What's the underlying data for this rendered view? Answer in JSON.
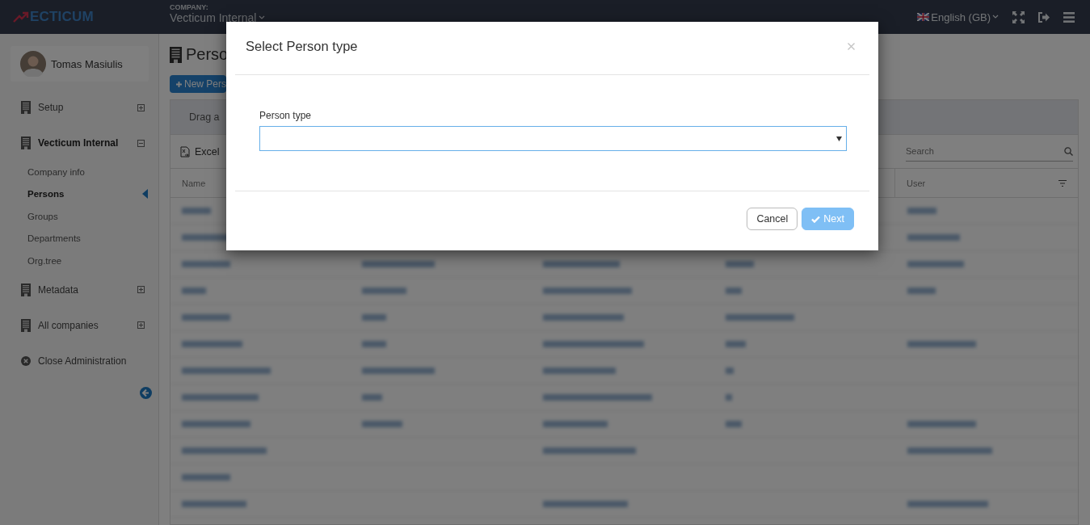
{
  "header": {
    "logo": "ECTICUM",
    "company_label": "COMPANY:",
    "company": "Vecticum Internal",
    "language": "English (GB)"
  },
  "sidebar": {
    "user": "Tomas Masiulis",
    "items": [
      {
        "kind": "group",
        "label": "Setup",
        "expanded": false
      },
      {
        "kind": "group",
        "label": "Vecticum Internal",
        "expanded": true,
        "children": [
          {
            "label": "Company info",
            "selected": false
          },
          {
            "label": "Persons",
            "selected": true
          },
          {
            "label": "Groups",
            "selected": false
          },
          {
            "label": "Departments",
            "selected": false
          },
          {
            "label": "Org.tree",
            "selected": false
          }
        ]
      },
      {
        "kind": "group",
        "label": "Metadata",
        "expanded": false
      },
      {
        "kind": "group",
        "label": "All companies",
        "expanded": false
      },
      {
        "kind": "action",
        "label": "Close Administration"
      }
    ]
  },
  "page": {
    "title": "Perso",
    "new_button": "New Pers",
    "group_hint": "Drag a",
    "export": "Excel",
    "search": {
      "placeholder": "Search"
    },
    "table": {
      "columns": [
        {
          "label": "Name"
        },
        {
          "label": "User",
          "filter": true
        }
      ]
    }
  },
  "dialog": {
    "title": "Select Person type",
    "field": {
      "label": "Person type",
      "focused": true
    },
    "buttons": [
      {
        "label": "Cancel",
        "kind": "secondary",
        "disabled": false
      },
      {
        "label": "Next",
        "kind": "primary",
        "disabled": true
      }
    ]
  }
}
